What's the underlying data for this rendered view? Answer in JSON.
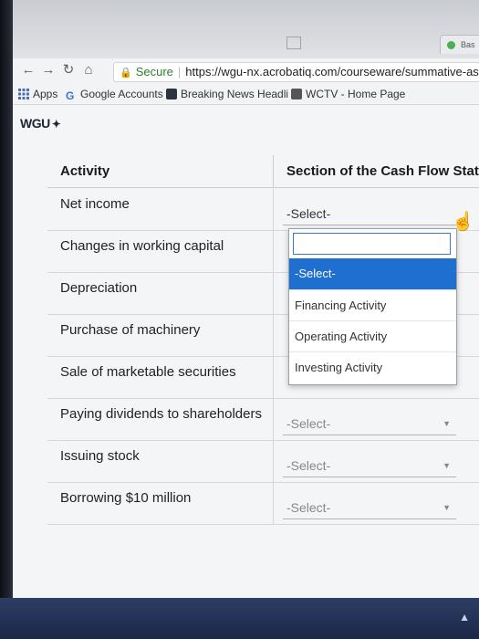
{
  "browser": {
    "tab_title": "Bas",
    "tab_close": "×",
    "secure_label": "Secure",
    "url": "https://wgu-nx.acrobatiq.com/courseware/summative-asse"
  },
  "bookmarks": [
    {
      "label": "Apps",
      "icon": "apps-grid-icon"
    },
    {
      "label": "Google Accounts",
      "icon": "google-g-icon"
    },
    {
      "label": "Breaking News Headli",
      "icon": "news-icon"
    },
    {
      "label": "WCTV - Home Page",
      "icon": "wctv-icon"
    }
  ],
  "page": {
    "brand": "WGU",
    "table": {
      "header_activity": "Activity",
      "header_section": "Section of the Cash Flow Stat",
      "rows": [
        {
          "activity": "Net income",
          "value": "-Select-"
        },
        {
          "activity": "Changes in working capital",
          "value": ""
        },
        {
          "activity": "Depreciation",
          "value": ""
        },
        {
          "activity": "Purchase of machinery",
          "value": ""
        },
        {
          "activity": "Sale of marketable securities",
          "value": ""
        },
        {
          "activity": "Paying dividends to shareholders",
          "value": "-Select-"
        },
        {
          "activity": "Issuing stock",
          "value": "-Select-"
        },
        {
          "activity": "Borrowing $10 million",
          "value": "-Select-"
        }
      ]
    },
    "dropdown": {
      "search_value": "",
      "options": [
        "-Select-",
        "Financing Activity",
        "Operating Activity",
        "Investing Activity"
      ],
      "selected_index": 0
    }
  }
}
